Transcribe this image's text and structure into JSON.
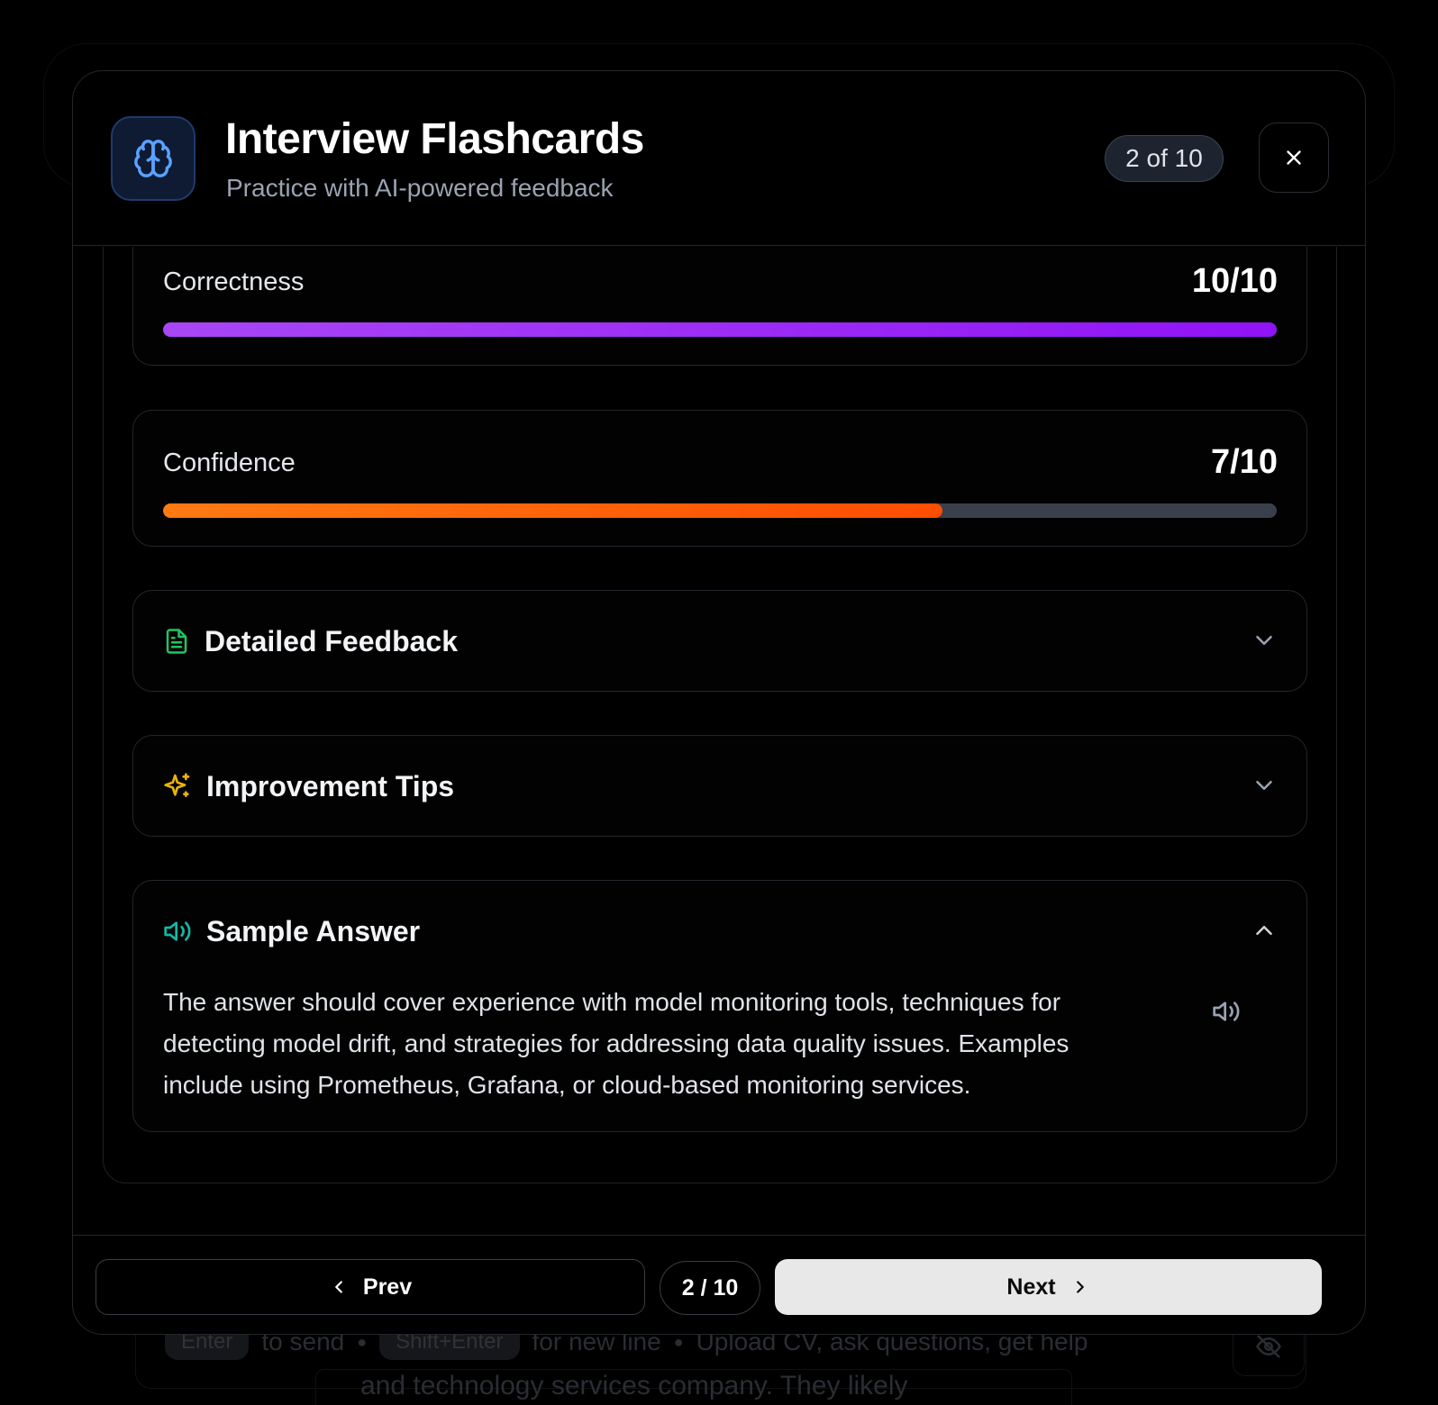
{
  "background": {
    "hints": {
      "enter_key": "Enter",
      "enter_text": "to send",
      "shift_key": "Shift+Enter",
      "shift_text": "for new line",
      "tagline": "Upload CV, ask questions, get help"
    },
    "snippet": "and technology services company. They likely"
  },
  "header": {
    "title": "Interview Flashcards",
    "subtitle": "Practice with AI-powered feedback",
    "counter": "2 of 10",
    "logo_icon": "brain-icon",
    "close_icon": "close-icon"
  },
  "metrics": [
    {
      "label": "Correctness",
      "score_text": "10/10",
      "value": 10,
      "max": 10,
      "color": "#9b1ff5"
    },
    {
      "label": "Confidence",
      "score_text": "7/10",
      "value": 7,
      "max": 10,
      "color": "#ff5a05"
    }
  ],
  "sections": {
    "detailed_feedback": {
      "title": "Detailed Feedback",
      "icon": "document-icon",
      "icon_color": "#22c55e",
      "expanded": false
    },
    "improvement_tips": {
      "title": "Improvement Tips",
      "icon": "sparkles-icon",
      "icon_color": "#eab308",
      "expanded": false
    },
    "sample_answer": {
      "title": "Sample Answer",
      "icon": "speaker-icon",
      "icon_color": "#14b8a6",
      "expanded": true,
      "text": "The answer should cover experience with model monitoring tools, techniques for detecting model drift, and strategies for addressing data quality issues. Examples include using Prometheus, Grafana, or cloud-based monitoring services."
    }
  },
  "footer": {
    "prev_label": "Prev",
    "page_indicator": "2 / 10",
    "next_label": "Next"
  }
}
